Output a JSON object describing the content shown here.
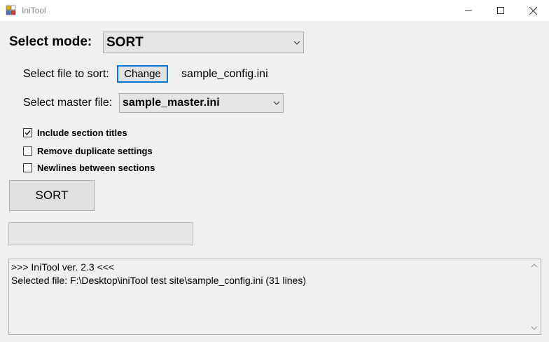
{
  "window": {
    "title": "IniTool"
  },
  "mode": {
    "label": "Select mode:",
    "selected": "SORT"
  },
  "file": {
    "label": "Select file to sort:",
    "change_button": "Change",
    "filename": "sample_config.ini"
  },
  "master": {
    "label": "Select master file:",
    "selected": "sample_master.ini"
  },
  "options": [
    {
      "label": "Include section titles",
      "checked": true
    },
    {
      "label": "Remove duplicate settings",
      "checked": false
    },
    {
      "label": "Newlines between sections",
      "checked": false
    }
  ],
  "action": {
    "sort_button": "SORT"
  },
  "progress": {
    "value": 0
  },
  "log": {
    "lines": [
      ">>> IniTool ver. 2.3 <<<",
      "Selected file: F:\\Desktop\\iniTool test site\\sample_config.ini (31 lines)"
    ]
  }
}
